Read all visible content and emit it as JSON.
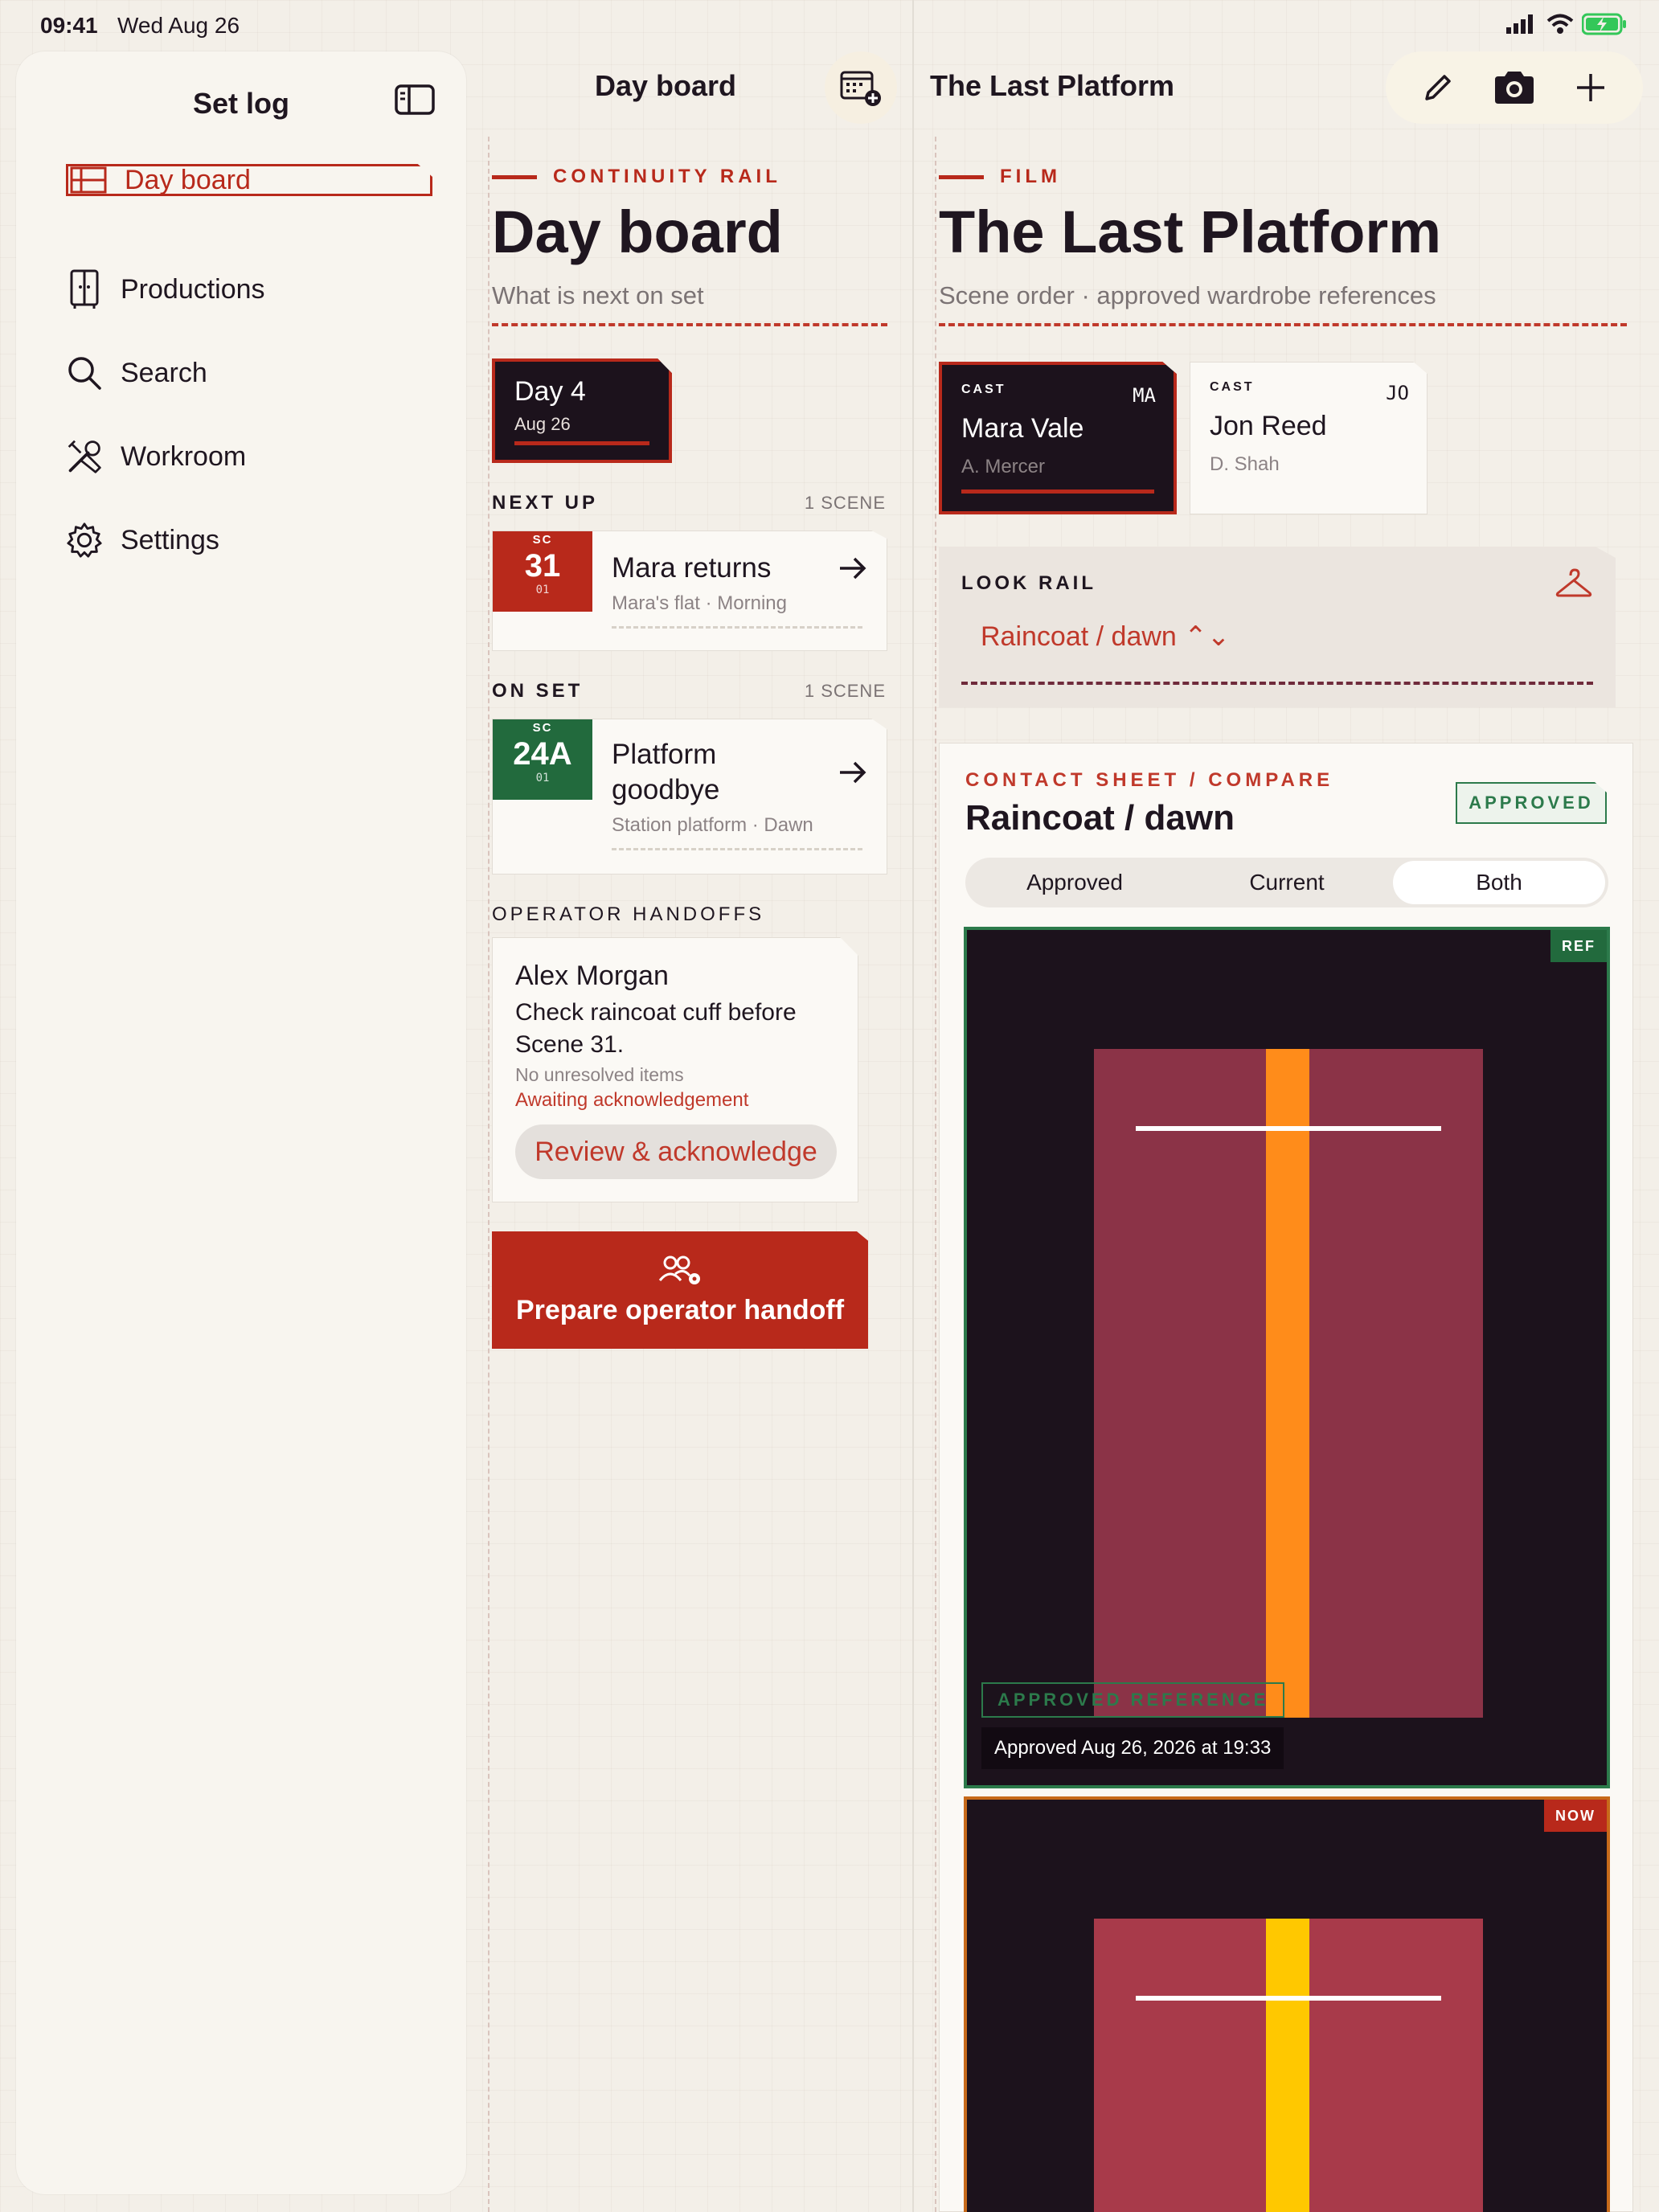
{
  "status_bar": {
    "time": "09:41",
    "date": "Wed Aug 26"
  },
  "sidebar": {
    "title": "Set log",
    "items": [
      {
        "label": "Day board",
        "icon": "day-board-icon",
        "active": true
      },
      {
        "label": "Productions",
        "icon": "wardrobe-icon"
      },
      {
        "label": "Search",
        "icon": "search-icon"
      },
      {
        "label": "Workroom",
        "icon": "tools-icon"
      },
      {
        "label": "Settings",
        "icon": "gear-icon"
      }
    ]
  },
  "middle": {
    "header": "Day board",
    "eyebrow": "CONTINUITY RAIL",
    "title": "Day board",
    "subtitle": "What is next on set",
    "day_chip": {
      "day": "Day 4",
      "date": "Aug 26"
    },
    "next_up": {
      "label": "NEXT UP",
      "count": "1 SCENE",
      "scene": {
        "sc": "SC",
        "number": "31",
        "sub": "01",
        "title": "Mara returns",
        "meta": "Mara's flat · Morning",
        "color": "#b8291b"
      }
    },
    "on_set": {
      "label": "ON SET",
      "count": "1 SCENE",
      "scene": {
        "sc": "SC",
        "number": "24A",
        "sub": "01",
        "title_line1": "Platform",
        "title_line2": "goodbye",
        "meta": "Station platform · Dawn",
        "color": "#226a3d"
      }
    },
    "handoffs": {
      "label": "OPERATOR HANDOFFS",
      "card": {
        "name": "Alex Morgan",
        "message": "Check raincoat cuff before Scene 31.",
        "status": "No unresolved items",
        "awaiting": "Awaiting acknowledgement",
        "action": "Review & acknowledge"
      }
    },
    "prepare_button": "Prepare operator handoff"
  },
  "right": {
    "header": "The Last Platform",
    "eyebrow": "FILM",
    "title": "The Last Platform",
    "subtitle": "Scene order · approved wardrobe references",
    "cast": [
      {
        "kind": "CAST",
        "initials": "MA",
        "name": "Mara Vale",
        "actor": "A. Mercer",
        "selected": true
      },
      {
        "kind": "CAST",
        "initials": "JO",
        "name": "Jon Reed",
        "actor": "D. Shah",
        "selected": false
      }
    ],
    "look_rail": {
      "label": "LOOK RAIL",
      "selected": "Raincoat / dawn ⌃⌄"
    },
    "contact_sheet": {
      "eyebrow": "CONTACT SHEET / COMPARE",
      "title": "Raincoat / dawn",
      "badge": "APPROVED",
      "segments": [
        "Approved",
        "Current",
        "Both"
      ],
      "selected_segment": "Both",
      "ref_frame": {
        "tag": "REF",
        "label": "APPROVED REFERENCE",
        "timestamp": "Approved Aug 26, 2026 at 19:33",
        "coat_color": "#8b3347",
        "stripe_color": "#ff8c1a"
      },
      "now_frame": {
        "tag": "NOW",
        "coat_color": "#a83a4a",
        "stripe_color": "#ffc800"
      }
    }
  },
  "colors": {
    "accent": "#b8291b",
    "ink": "#1c121c",
    "green": "#226a3d"
  }
}
